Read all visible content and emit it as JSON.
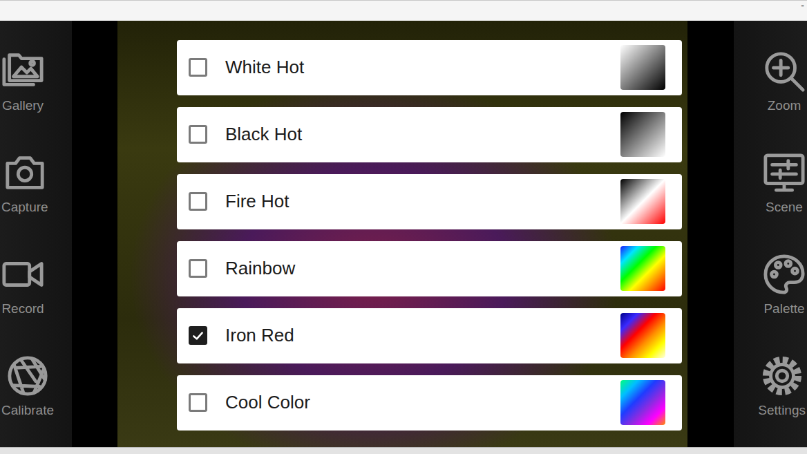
{
  "window": {
    "controls": [
      "-"
    ]
  },
  "left_toolbar": [
    {
      "label": "Gallery"
    },
    {
      "label": "Capture"
    },
    {
      "label": "Record"
    },
    {
      "label": "Calibrate"
    }
  ],
  "right_toolbar": [
    {
      "label": "Zoom"
    },
    {
      "label": "Scene"
    },
    {
      "label": "Palette"
    },
    {
      "label": "Settings"
    }
  ],
  "palettes": [
    {
      "name": "White Hot",
      "checked": false,
      "colors": [
        "#ffffff",
        "#000000"
      ]
    },
    {
      "name": "Black Hot",
      "checked": false,
      "colors": [
        "#000000",
        "#ffffff"
      ]
    },
    {
      "name": "Fire Hot",
      "checked": false,
      "colors": [
        "#000000",
        "#ffffff",
        "#ff0000"
      ]
    },
    {
      "name": "Rainbow",
      "checked": false,
      "colors": [
        "#1a1aff",
        "#00e5ff",
        "#00ff00",
        "#ffff00",
        "#ff7f00",
        "#ff0000"
      ]
    },
    {
      "name": "Iron Red",
      "checked": true,
      "colors": [
        "#00008b",
        "#3a2aff",
        "#ff0000",
        "#ff8c00",
        "#ffff00",
        "#ffffe0"
      ]
    },
    {
      "name": "Cool Color",
      "checked": false,
      "colors": [
        "#00ff7f",
        "#00bfff",
        "#1e3cff",
        "#8a2be2",
        "#ff00ff",
        "#ff8c00"
      ]
    }
  ]
}
